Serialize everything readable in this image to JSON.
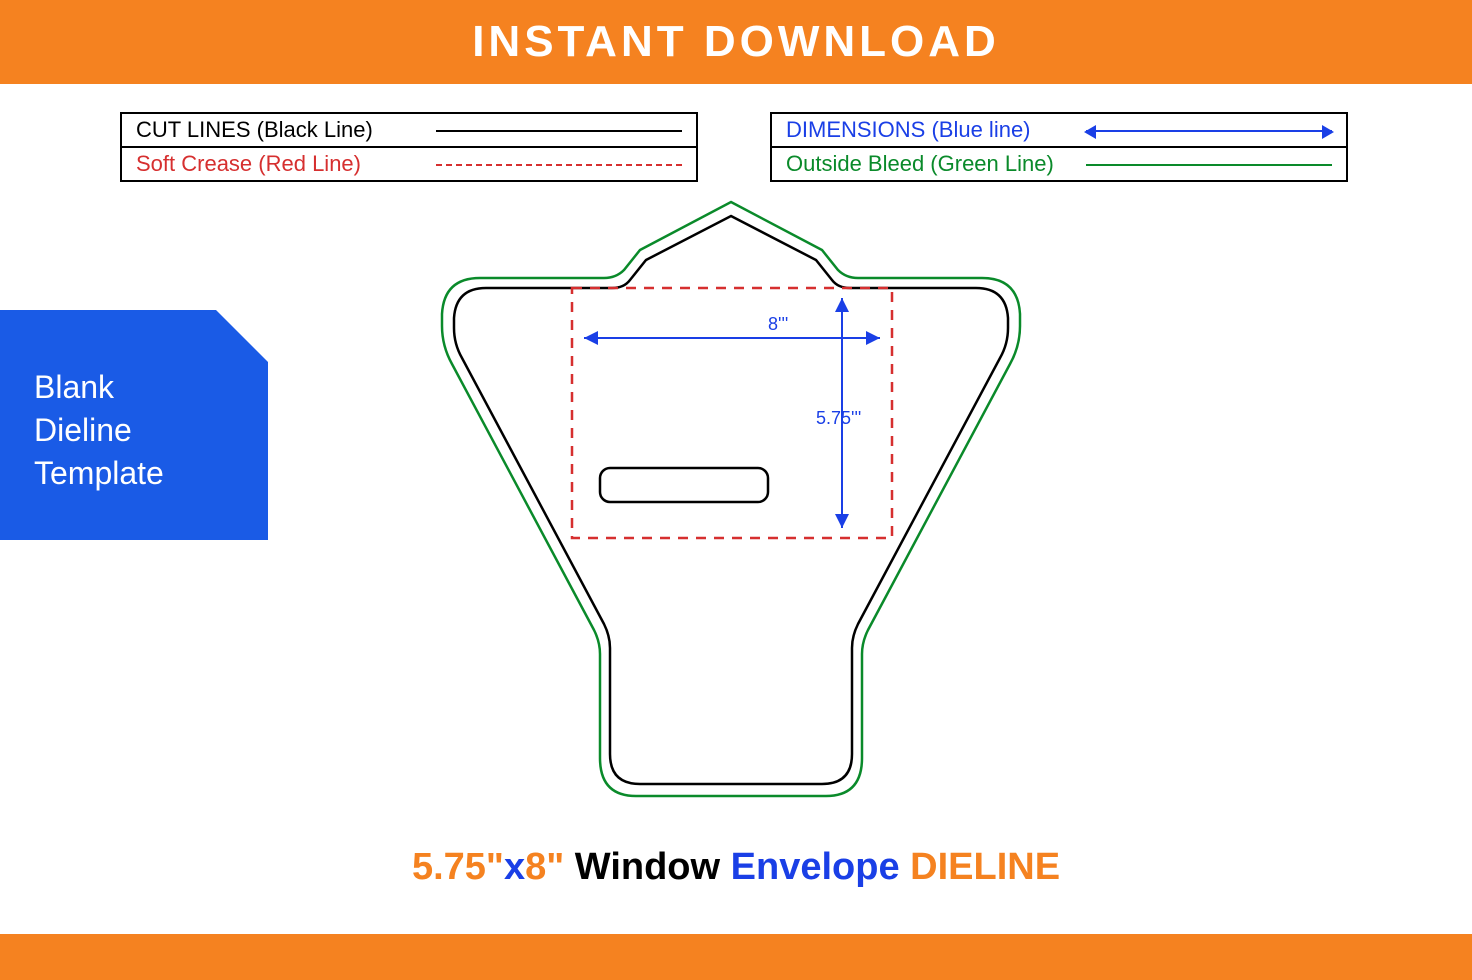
{
  "header": {
    "title": "INSTANT DOWNLOAD"
  },
  "legend": {
    "left": {
      "row1": "CUT LINES (Black Line)",
      "row2": "Soft Crease (Red Line)"
    },
    "right": {
      "row1": "DIMENSIONS (Blue line)",
      "row2": "Outside Bleed (Green Line)"
    }
  },
  "badge": {
    "line1": "Blank",
    "line2": "Dieline",
    "line3": "Template"
  },
  "dimensions": {
    "width": "8'''",
    "height": "5.75'''"
  },
  "title": {
    "p1": "5.75\"",
    "p2": "x",
    "p3": "8\"",
    "p4": " Window ",
    "p5": "Envelope ",
    "p6": "DIELINE"
  }
}
